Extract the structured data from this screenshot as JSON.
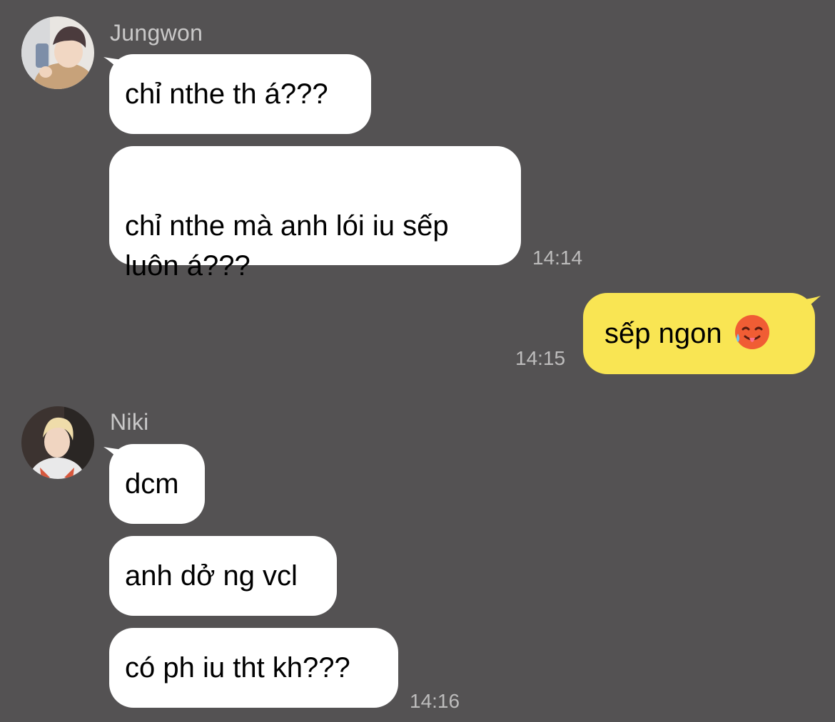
{
  "conversation": [
    {
      "type": "group",
      "sender": "Jungwon",
      "avatar_icon": "jungwon-avatar",
      "messages": [
        {
          "text": "chỉ nthe th á???"
        },
        {
          "text": "chỉ nthe mà anh lói iu sếp\nluôn á???"
        }
      ],
      "time": "14:14"
    },
    {
      "type": "mine",
      "messages": [
        {
          "text": "sếp ngon",
          "emoji_icon": "hot-face-emoji"
        }
      ],
      "time": "14:15"
    },
    {
      "type": "group",
      "sender": "Niki",
      "avatar_icon": "niki-avatar",
      "messages": [
        {
          "text": "dcm"
        },
        {
          "text": "anh dở ng vcl"
        },
        {
          "text": "có ph iu tht kh???"
        }
      ],
      "time": "14:16"
    }
  ],
  "colors": {
    "background": "#545253",
    "incoming_bubble": "#ffffff",
    "outgoing_bubble": "#f9e553",
    "name_text": "#c9c8c8",
    "time_text": "#bdbcbc"
  }
}
